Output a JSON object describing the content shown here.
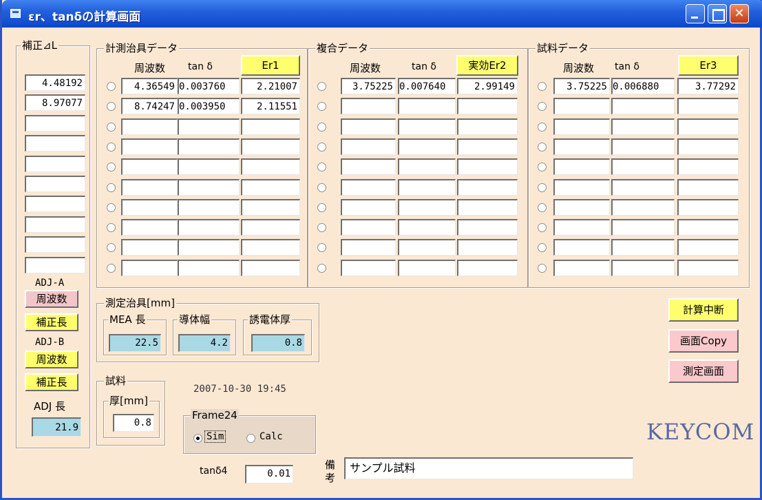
{
  "window": {
    "title": "εr、tanδの計算画面"
  },
  "correction": {
    "label": "補正⊿L",
    "values": [
      "4.48192",
      "8.97077",
      "",
      "",
      "",
      "",
      "",
      "",
      "",
      ""
    ]
  },
  "adj": {
    "adj_a_label": "ADJ-A",
    "adj_a_freq": "周波数",
    "adj_a_corr": "補正長",
    "adj_b_label": "ADJ-B",
    "adj_b_freq": "周波数",
    "adj_b_corr": "補正長",
    "length_label": "ADJ 長",
    "length_value": "21.9"
  },
  "fixture_data": {
    "label": "計測治具データ",
    "col_freq": "周波数",
    "col_tan": "tan δ",
    "button": "Er1",
    "rows": [
      {
        "freq": "4.36549",
        "tan": "0.003760",
        "er": "2.21007"
      },
      {
        "freq": "8.74247",
        "tan": "0.003950",
        "er": "2.11551"
      },
      {
        "freq": "",
        "tan": "",
        "er": ""
      },
      {
        "freq": "",
        "tan": "",
        "er": ""
      },
      {
        "freq": "",
        "tan": "",
        "er": ""
      },
      {
        "freq": "",
        "tan": "",
        "er": ""
      },
      {
        "freq": "",
        "tan": "",
        "er": ""
      },
      {
        "freq": "",
        "tan": "",
        "er": ""
      },
      {
        "freq": "",
        "tan": "",
        "er": ""
      },
      {
        "freq": "",
        "tan": "",
        "er": ""
      }
    ]
  },
  "composite_data": {
    "label": "複合データ",
    "col_freq": "周波数",
    "col_tan": "tan δ",
    "button": "実効Er2",
    "rows": [
      {
        "freq": "3.75225",
        "tan": "0.007640",
        "er": "2.99149"
      },
      {
        "freq": "",
        "tan": "",
        "er": ""
      },
      {
        "freq": "",
        "tan": "",
        "er": ""
      },
      {
        "freq": "",
        "tan": "",
        "er": ""
      },
      {
        "freq": "",
        "tan": "",
        "er": ""
      },
      {
        "freq": "",
        "tan": "",
        "er": ""
      },
      {
        "freq": "",
        "tan": "",
        "er": ""
      },
      {
        "freq": "",
        "tan": "",
        "er": ""
      },
      {
        "freq": "",
        "tan": "",
        "er": ""
      },
      {
        "freq": "",
        "tan": "",
        "er": ""
      }
    ]
  },
  "sample_data": {
    "label": "試料データ",
    "col_freq": "周波数",
    "col_tan": "tan δ",
    "button": "Er3",
    "rows": [
      {
        "freq": "3.75225",
        "tan": "0.006880",
        "er": "3.77292"
      },
      {
        "freq": "",
        "tan": "",
        "er": ""
      },
      {
        "freq": "",
        "tan": "",
        "er": ""
      },
      {
        "freq": "",
        "tan": "",
        "er": ""
      },
      {
        "freq": "",
        "tan": "",
        "er": ""
      },
      {
        "freq": "",
        "tan": "",
        "er": ""
      },
      {
        "freq": "",
        "tan": "",
        "er": ""
      },
      {
        "freq": "",
        "tan": "",
        "er": ""
      },
      {
        "freq": "",
        "tan": "",
        "er": ""
      },
      {
        "freq": "",
        "tan": "",
        "er": ""
      }
    ]
  },
  "fixture_dims": {
    "label": "測定治具[mm]",
    "mea_label": "MEA 長",
    "mea_value": "22.5",
    "conductor_label": "導体幅",
    "conductor_value": "4.2",
    "dielectric_label": "誘電体厚",
    "dielectric_value": "0.8"
  },
  "sample": {
    "label": "試料",
    "thickness_label": "厚[mm]",
    "thickness_value": "0.8"
  },
  "timestamp": "2007-10-30 19:45",
  "mode_frame": {
    "label": "Frame24",
    "sim": "Sim",
    "calc": "Calc"
  },
  "tan4": {
    "label": "tanδ4",
    "value": "0.01"
  },
  "remarks": {
    "label_1": "備",
    "label_2": "考",
    "value": "サンプル試料"
  },
  "actions": {
    "abort": "計算中断",
    "copy": "画面Copy",
    "measure": "測定画面"
  },
  "brand": "KEYCOM"
}
